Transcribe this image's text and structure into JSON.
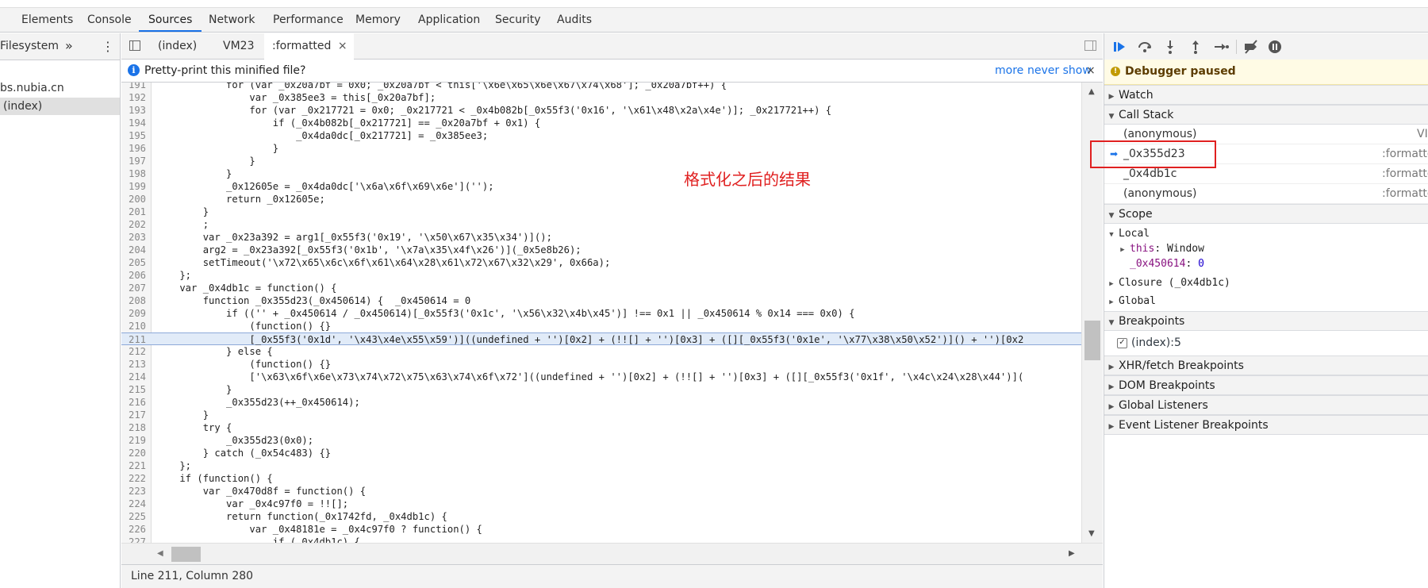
{
  "main_tabs": [
    "Elements",
    "Console",
    "Sources",
    "Network",
    "Performance",
    "Memory",
    "Application",
    "Security",
    "Audits"
  ],
  "active_main_tab": "Sources",
  "navigator": {
    "tab": "Filesystem",
    "more_label": "»",
    "menu_label": "⋮",
    "items": [
      "bs.nubia.cn",
      "(index)"
    ]
  },
  "editor_tabs": [
    "(index)",
    "VM23",
    ":formatted"
  ],
  "editor_tab_close": "×",
  "infobar": {
    "message": "Pretty-print this minified file?",
    "more": "more",
    "never_show": "never show",
    "close": "×"
  },
  "code": {
    "lines": [
      {
        "n": "191",
        "t": "            for (var _0x20a7bf = 0x0; _0x20a7bf < this['\\x6e\\x65\\x6e\\x67\\x74\\x68']; _0x20a7bf++) {"
      },
      {
        "n": "192",
        "t": "                var _0x385ee3 = this[_0x20a7bf];"
      },
      {
        "n": "193",
        "t": "                for (var _0x217721 = 0x0; _0x217721 < _0x4b082b[_0x55f3('0x16', '\\x61\\x48\\x2a\\x4e')]; _0x217721++) {"
      },
      {
        "n": "194",
        "t": "                    if (_0x4b082b[_0x217721] == _0x20a7bf + 0x1) {"
      },
      {
        "n": "195",
        "t": "                        _0x4da0dc[_0x217721] = _0x385ee3;"
      },
      {
        "n": "196",
        "t": "                    }"
      },
      {
        "n": "197",
        "t": "                }"
      },
      {
        "n": "198",
        "t": "            }"
      },
      {
        "n": "199",
        "t": "            _0x12605e = _0x4da0dc['\\x6a\\x6f\\x69\\x6e']('');"
      },
      {
        "n": "200",
        "t": "            return _0x12605e;"
      },
      {
        "n": "201",
        "t": "        }"
      },
      {
        "n": "202",
        "t": "        ;"
      },
      {
        "n": "203",
        "t": "        var _0x23a392 = arg1[_0x55f3('0x19', '\\x50\\x67\\x35\\x34')]();"
      },
      {
        "n": "204",
        "t": "        arg2 = _0x23a392[_0x55f3('0x1b', '\\x7a\\x35\\x4f\\x26')](_0x5e8b26);"
      },
      {
        "n": "205",
        "t": "        setTimeout('\\x72\\x65\\x6c\\x6f\\x61\\x64\\x28\\x61\\x72\\x67\\x32\\x29', 0x66a);"
      },
      {
        "n": "206",
        "t": "    };"
      },
      {
        "n": "207",
        "t": "    var _0x4db1c = function() {"
      },
      {
        "n": "208",
        "t": "        function _0x355d23(_0x450614) {  _0x450614 = 0"
      },
      {
        "n": "209",
        "t": "            if (('' + _0x450614 / _0x450614)[_0x55f3('0x1c', '\\x56\\x32\\x4b\\x45')] !== 0x1 || _0x450614 % 0x14 === 0x0) {"
      },
      {
        "n": "210",
        "t": "                (function() {}"
      },
      {
        "n": "211",
        "t": "                [_0x55f3('0x1d', '\\x43\\x4e\\x55\\x59')]((undefined + '')[0x2] + (!![] + '')[0x3] + ([][_0x55f3('0x1e', '\\x77\\x38\\x50\\x52')]() + '')[0x2"
      },
      {
        "n": "212",
        "t": "            } else {"
      },
      {
        "n": "213",
        "t": "                (function() {}"
      },
      {
        "n": "214",
        "t": "                ['\\x63\\x6f\\x6e\\x73\\x74\\x72\\x75\\x63\\x74\\x6f\\x72']((undefined + '')[0x2] + (!![] + '')[0x3] + ([][_0x55f3('0x1f', '\\x4c\\x24\\x28\\x44')]("
      },
      {
        "n": "215",
        "t": "            }"
      },
      {
        "n": "216",
        "t": "            _0x355d23(++_0x450614);"
      },
      {
        "n": "217",
        "t": "        }"
      },
      {
        "n": "218",
        "t": "        try {"
      },
      {
        "n": "219",
        "t": "            _0x355d23(0x0);"
      },
      {
        "n": "220",
        "t": "        } catch (_0x54c483) {}"
      },
      {
        "n": "221",
        "t": "    };"
      },
      {
        "n": "222",
        "t": "    if (function() {"
      },
      {
        "n": "223",
        "t": "        var _0x470d8f = function() {"
      },
      {
        "n": "224",
        "t": "            var _0x4c97f0 = !![];"
      },
      {
        "n": "225",
        "t": "            return function(_0x1742fd, _0x4db1c) {"
      },
      {
        "n": "226",
        "t": "                var _0x48181e = _0x4c97f0 ? function() {"
      },
      {
        "n": "227",
        "t": "                    if (_0x4db1c) {"
      },
      {
        "n": "228",
        "t": ""
      }
    ],
    "highlighted_line": "211"
  },
  "status": "Line 211, Column 280",
  "annotation": "格式化之后的结果",
  "debugger": {
    "paused_message": "Debugger paused",
    "sections": {
      "watch": "Watch",
      "call_stack": "Call Stack",
      "scope": "Scope",
      "breakpoints": "Breakpoints",
      "xhr": "XHR/fetch Breakpoints",
      "dom": "DOM Breakpoints",
      "global_listeners": "Global Listeners",
      "event_listener": "Event Listener Breakpoints"
    },
    "call_stack": [
      {
        "name": "(anonymous)",
        "loc": "VI"
      },
      {
        "name": "_0x355d23",
        "loc": ":formatte"
      },
      {
        "name": "_0x4db1c",
        "loc": ":formatte"
      },
      {
        "name": "(anonymous)",
        "loc": ":formatte"
      }
    ],
    "scope": {
      "local": "Local",
      "this_name": "this",
      "this_val": "Window",
      "var_name": "_0x450614",
      "var_val": "0",
      "closure": "Closure (_0x4db1c)",
      "global": "Global"
    },
    "breakpoint_item": "(index):5"
  }
}
